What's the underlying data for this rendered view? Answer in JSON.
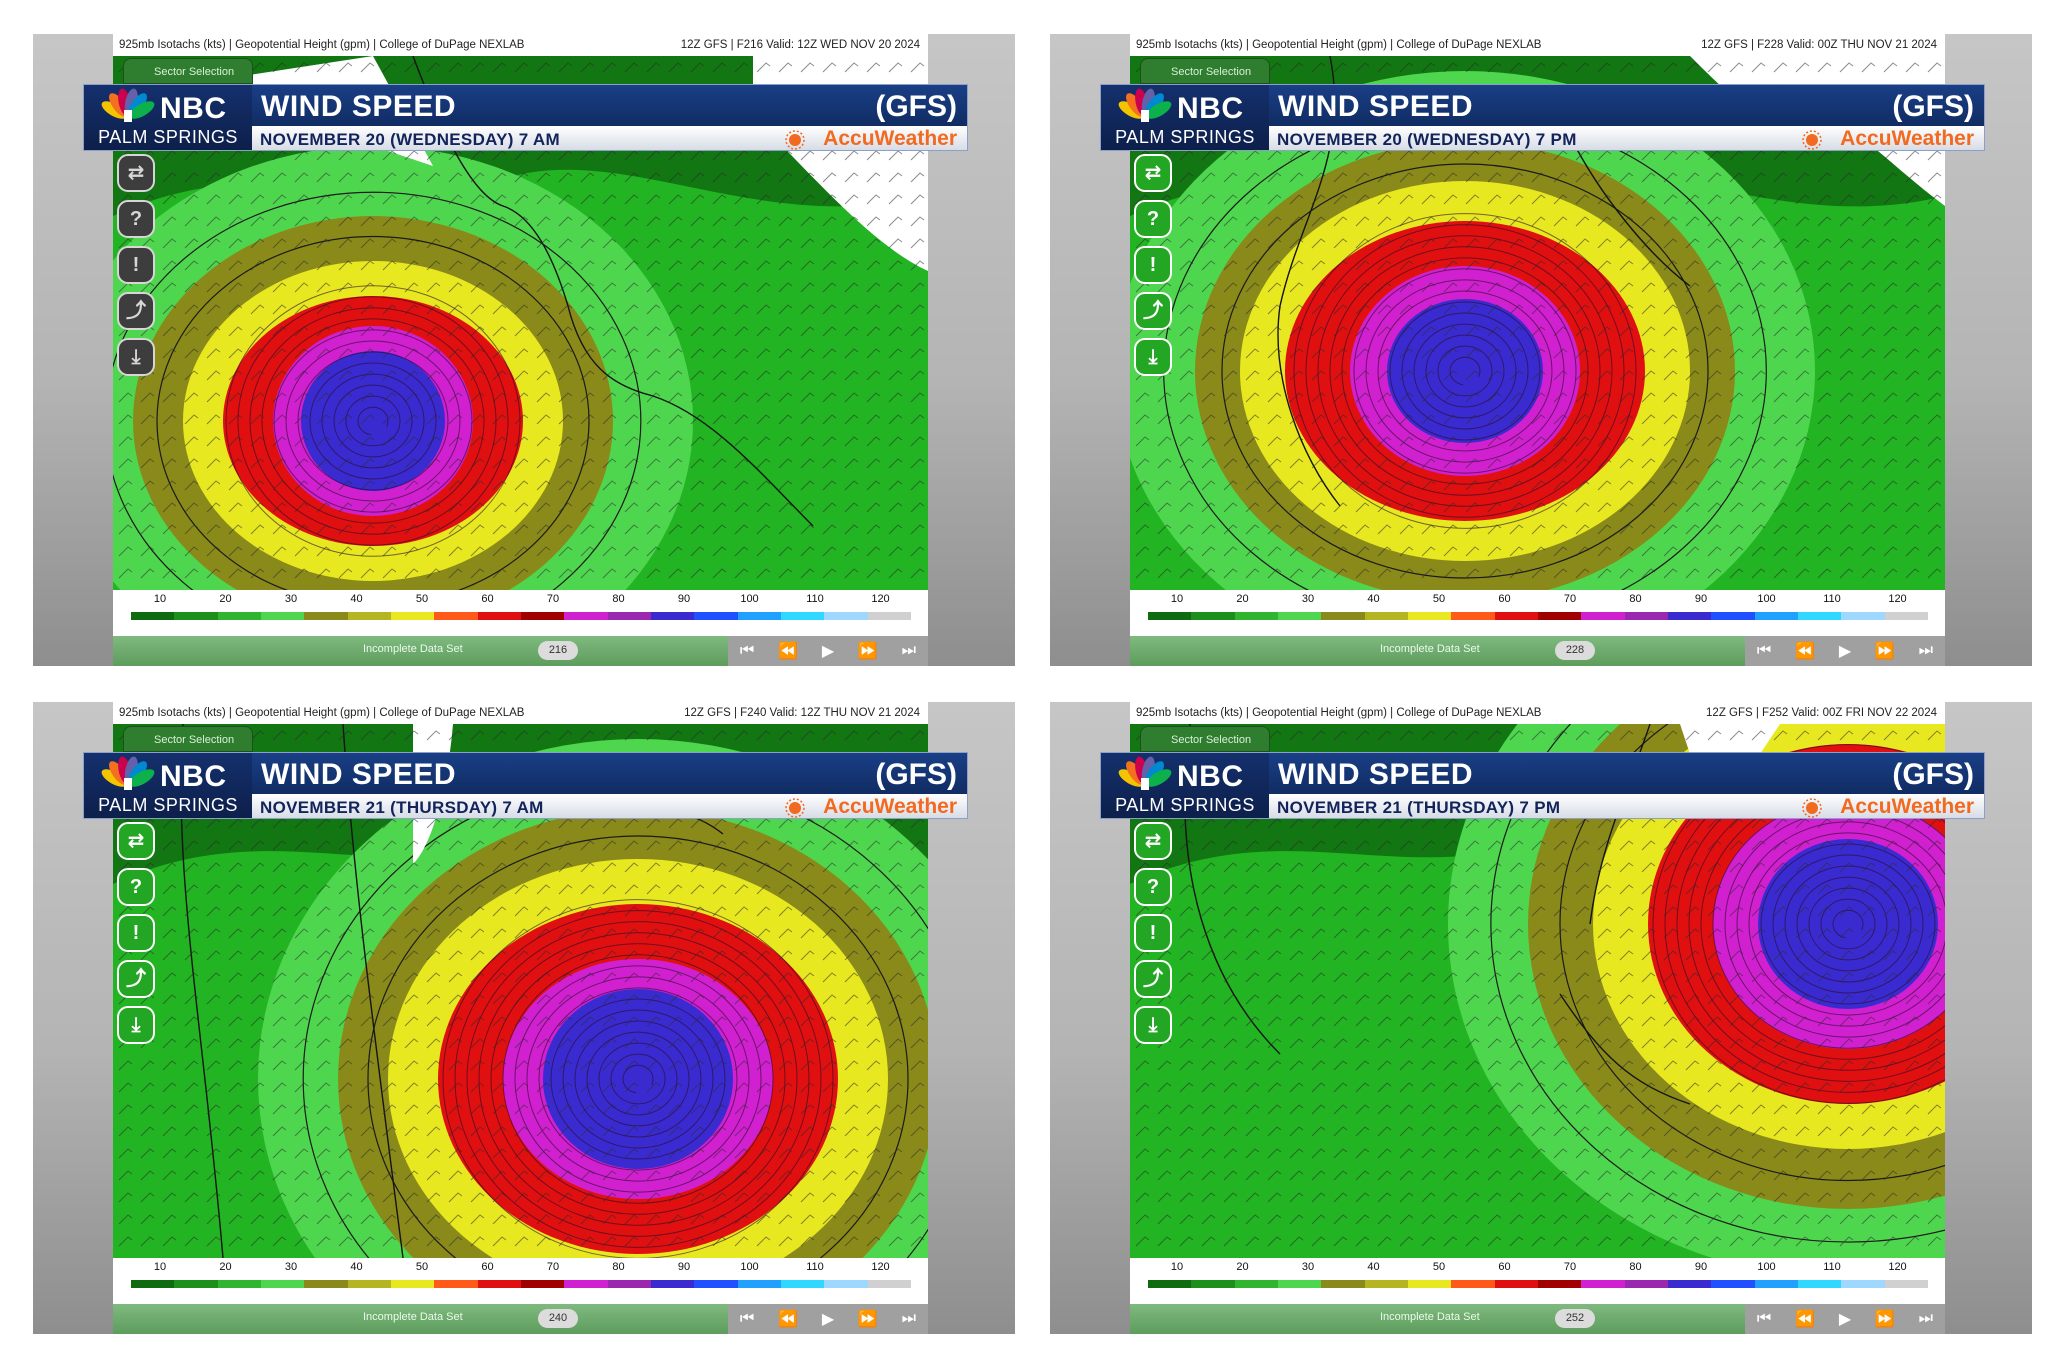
{
  "panels": [
    {
      "subtitle_left": "925mb Isotachs (kts) | Geopotential Height (gpm) | College of DuPage NEXLAB",
      "subtitle_right": "12Z GFS | F216 Valid: 12Z WED NOV 20 2024",
      "station": "NBC",
      "city": "PALM SPRINGS",
      "title": "WIND SPEED",
      "model": "(GFS)",
      "date": "NOVEMBER 20 (WEDNESDAY) 7 AM",
      "brand": "AccuWeather",
      "sector": "Sector Selection",
      "status": "Incomplete Data Set",
      "frame": "216"
    },
    {
      "subtitle_left": "925mb Isotachs (kts) | Geopotential Height (gpm) | College of DuPage NEXLAB",
      "subtitle_right": "12Z GFS | F228 Valid: 00Z THU NOV 21 2024",
      "station": "NBC",
      "city": "PALM SPRINGS",
      "title": "WIND SPEED",
      "model": "(GFS)",
      "date": "NOVEMBER 20 (WEDNESDAY) 7 PM",
      "brand": "AccuWeather",
      "sector": "Sector Selection",
      "status": "Incomplete Data Set",
      "frame": "228"
    },
    {
      "subtitle_left": "925mb Isotachs (kts) | Geopotential Height (gpm) | College of DuPage NEXLAB",
      "subtitle_right": "12Z GFS | F240 Valid: 12Z THU NOV 21 2024",
      "station": "NBC",
      "city": "PALM SPRINGS",
      "title": "WIND SPEED",
      "model": "(GFS)",
      "date": "NOVEMBER 21 (THURSDAY) 7 AM",
      "brand": "AccuWeather",
      "sector": "Sector Selection",
      "status": "Incomplete Data Set",
      "frame": "240"
    },
    {
      "subtitle_left": "925mb Isotachs (kts) | Geopotential Height (gpm) | College of DuPage NEXLAB",
      "subtitle_right": "12Z GFS | F252 Valid: 00Z FRI NOV 22 2024",
      "station": "NBC",
      "city": "PALM SPRINGS",
      "title": "WIND SPEED",
      "model": "(GFS)",
      "date": "NOVEMBER 21 (THURSDAY) 7 PM",
      "brand": "AccuWeather",
      "sector": "Sector Selection",
      "status": "Incomplete Data Set",
      "frame": "252"
    }
  ],
  "scale": {
    "ticks": [
      "10",
      "20",
      "30",
      "40",
      "50",
      "60",
      "70",
      "80",
      "90",
      "100",
      "110",
      "120"
    ],
    "colors": [
      "#0f6b0f",
      "#1d8f1d",
      "#2fb52f",
      "#4fd64f",
      "#8a8a1a",
      "#b5b524",
      "#e8e820",
      "#ff5a1a",
      "#e01010",
      "#a00000",
      "#d020d0",
      "#9b27b0",
      "#3a2bd0",
      "#2050ff",
      "#20a0ff",
      "#30d8ff",
      "#9fd8ff",
      "#d0d0d0"
    ]
  },
  "icons": {
    "tools": [
      "sector-swap-icon",
      "help-icon",
      "alert-icon",
      "share-icon",
      "download-icon"
    ],
    "controls": [
      "skip-back-icon",
      "rewind-icon",
      "play-icon",
      "fast-forward-icon",
      "skip-forward-icon"
    ]
  },
  "colors": {
    "wind_10": "#0f6b0f",
    "wind_20": "#22b422",
    "wind_30": "#4fd64f",
    "wind_40": "#8a8a1a",
    "wind_50": "#e8e820",
    "wind_60": "#e01010",
    "wind_70": "#d020d0",
    "wind_80": "#3a2bd0",
    "banner_blue": "#1a3f86",
    "accuweather_orange": "#f26a1f"
  }
}
